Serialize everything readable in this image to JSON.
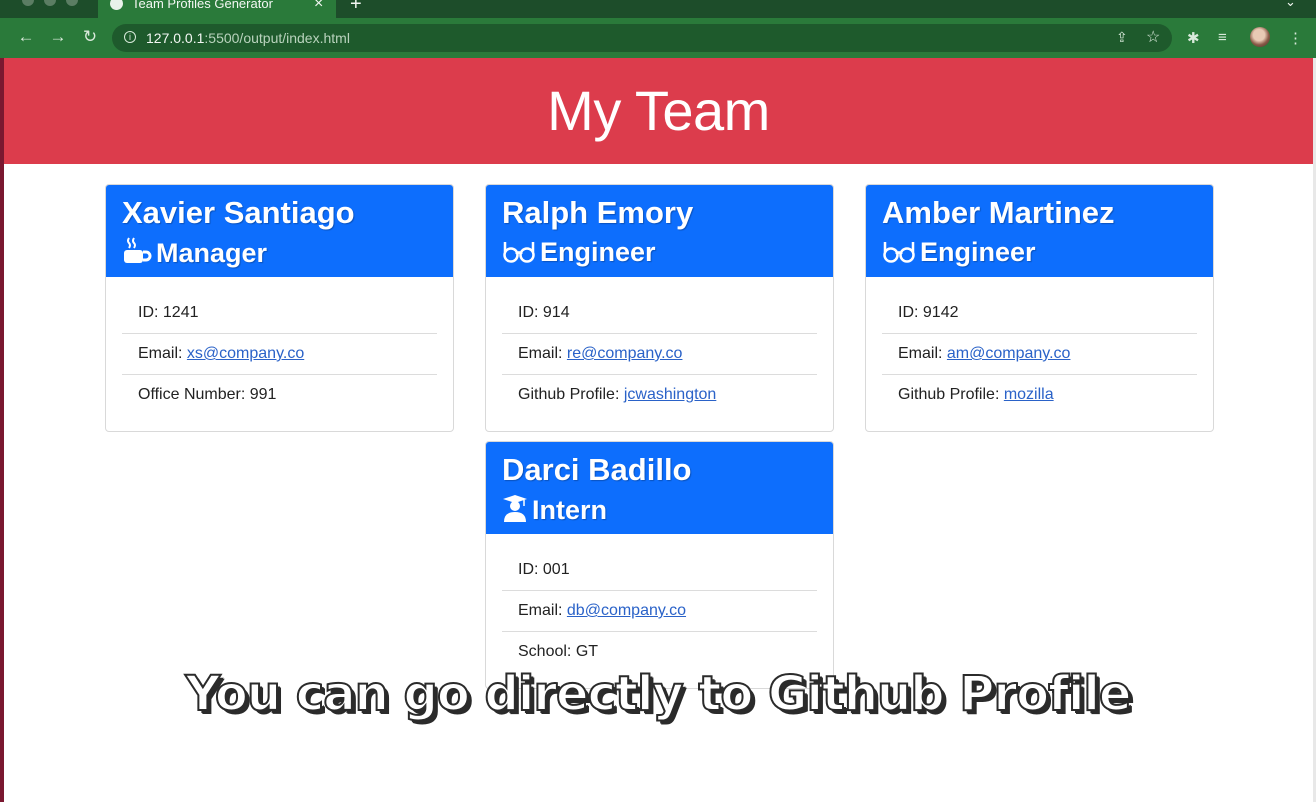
{
  "browser": {
    "tab_title": "Team Profiles Generator",
    "url_host": "127.0.0.1",
    "url_path": ":5500/output/index.html"
  },
  "page": {
    "heading": "My Team"
  },
  "cards": [
    {
      "name": "Xavier Santiago",
      "role": "Manager",
      "role_icon": "coffee-icon",
      "id_text": "ID: 1241",
      "email_label": "Email: ",
      "email": "xs@company.co",
      "extra_label": "Office Number: ",
      "extra_value": "991"
    },
    {
      "name": "Ralph Emory",
      "role": "Engineer",
      "role_icon": "glasses-icon",
      "id_text": "ID: 914",
      "email_label": "Email: ",
      "email": "re@company.co",
      "extra_label": "Github Profile: ",
      "extra_value": "jcwashington"
    },
    {
      "name": "Amber Martinez",
      "role": "Engineer",
      "role_icon": "glasses-icon",
      "id_text": "ID: 9142",
      "email_label": "Email: ",
      "email": "am@company.co",
      "extra_label": "Github Profile: ",
      "extra_value": "mozilla"
    },
    {
      "name": "Darci Badillo",
      "role": "Intern",
      "role_icon": "graduate-icon",
      "id_text": "ID: 001",
      "email_label": "Email: ",
      "email": "db@company.co",
      "extra_label": "School: ",
      "extra_value": "GT"
    }
  ],
  "caption": "You can go directly to Github Profile",
  "colors": {
    "hero": "#dc3c4c",
    "card_header": "#0d6efd",
    "link": "#2a62c8",
    "browser_frame": "#2a7a3a"
  }
}
